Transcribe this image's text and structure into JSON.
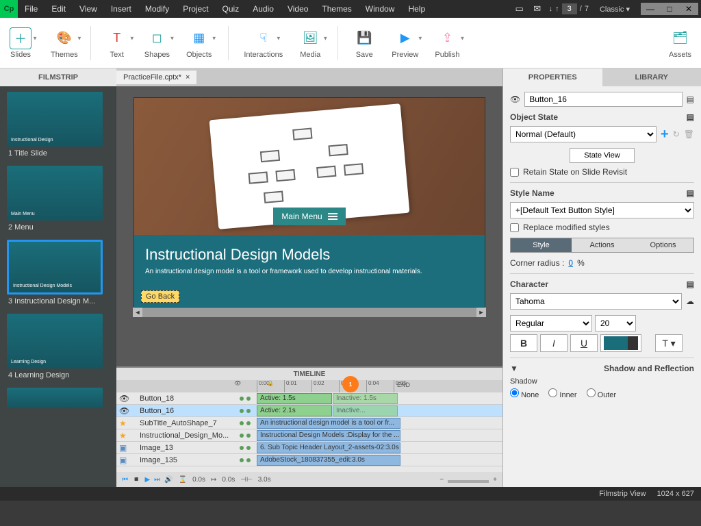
{
  "menubar": [
    "File",
    "Edit",
    "View",
    "Insert",
    "Modify",
    "Project",
    "Quiz",
    "Audio",
    "Video",
    "Themes",
    "Window",
    "Help"
  ],
  "page": {
    "current": "3",
    "total": "7"
  },
  "workspace": "Classic",
  "toolbar": {
    "slides": "Slides",
    "themes": "Themes",
    "text": "Text",
    "shapes": "Shapes",
    "objects": "Objects",
    "interactions": "Interactions",
    "media": "Media",
    "save": "Save",
    "preview": "Preview",
    "publish": "Publish",
    "assets": "Assets"
  },
  "filmstrip": {
    "title": "FILMSTRIP",
    "items": [
      {
        "label": "1 Title Slide",
        "caption": "Instructional Design"
      },
      {
        "label": "2 Menu",
        "caption": "Main Menu"
      },
      {
        "label": "3 Instructional Design M...",
        "caption": "Instructional Design Models",
        "selected": true
      },
      {
        "label": "4 Learning Design",
        "caption": "Learning Design"
      }
    ]
  },
  "doc_tab": "PracticeFile.cptx*",
  "canvas": {
    "main_menu": "Main Menu",
    "title": "Instructional Design Models",
    "subtitle": "An instructional design model is a tool or framework used to develop instructional materials.",
    "goback": "Go Back"
  },
  "timeline": {
    "title": "TIMELINE",
    "marks": [
      "0:00",
      "0:01",
      "0:02",
      "0:03",
      "0:04",
      "0:05"
    ],
    "end": "END",
    "marker": "1",
    "rows": [
      {
        "icon": "eye",
        "name": "Button_18",
        "bar": "Active: 1.5s",
        "bar2": "Inactive: 1.5s",
        "color": "green"
      },
      {
        "icon": "eye",
        "name": "Button_16",
        "bar": "Active: 2.1s",
        "bar2": "Inactive...",
        "color": "green",
        "selected": true
      },
      {
        "icon": "star",
        "name": "SubTitle_AutoShape_7",
        "bar": "An instructional design model is a tool or fr...",
        "color": "blue"
      },
      {
        "icon": "star",
        "name": "Instructional_Design_Mo...",
        "bar": "Instructional Design Models :Display for the ...",
        "color": "blue"
      },
      {
        "icon": "img",
        "name": "Image_13",
        "bar": "6. Sub Topic Header Layout_2-assets-02:3.0s",
        "color": "blue"
      },
      {
        "icon": "img",
        "name": "Image_135",
        "bar": "AdobeStock_180837355_edit:3.0s",
        "color": "blue"
      }
    ],
    "controls": {
      "t1": "0.0s",
      "t2": "0.0s",
      "t3": "3.0s"
    }
  },
  "properties": {
    "tab_properties": "PROPERTIES",
    "tab_library": "LIBRARY",
    "object_name": "Button_16",
    "object_state": "Object State",
    "state_value": "Normal (Default)",
    "state_view": "State View",
    "retain": "Retain State on Slide Revisit",
    "style_name": "Style Name",
    "style_value": "+[Default Text Button Style]",
    "replace": "Replace modified styles",
    "tabs": {
      "style": "Style",
      "actions": "Actions",
      "options": "Options"
    },
    "corner": "Corner radius :",
    "corner_val": "0",
    "corner_unit": "%",
    "character": "Character",
    "font": "Tahoma",
    "weight": "Regular",
    "size": "20",
    "shadow_section": "Shadow and Reflection",
    "shadow": "Shadow",
    "radios": {
      "none": "None",
      "inner": "Inner",
      "outer": "Outer"
    }
  },
  "status": {
    "view": "Filmstrip View",
    "dims": "1024 x 627"
  }
}
